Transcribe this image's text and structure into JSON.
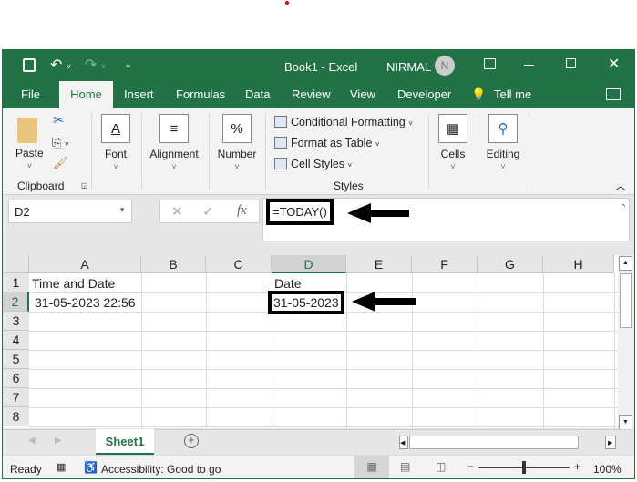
{
  "title": {
    "doc": "Book1",
    "sep": "-",
    "app": "Excel",
    "user": "NIRMAL",
    "avatar": "N"
  },
  "tabs": [
    "File",
    "Home",
    "Insert",
    "Formulas",
    "Data",
    "Review",
    "View",
    "Developer",
    "Tell me"
  ],
  "ribbon": {
    "paste": "Paste",
    "clipboard": "Clipboard",
    "font": "Font",
    "alignment": "Alignment",
    "number": "Number",
    "number_icon": "%",
    "font_icon": "A",
    "cond": "Conditional Formatting",
    "fmt_table": "Format as Table",
    "cell_styles": "Cell Styles",
    "styles": "Styles",
    "cells": "Cells",
    "editing": "Editing"
  },
  "formula": {
    "namebox": "D2",
    "value": "=TODAY()",
    "fx": "fx"
  },
  "columns": [
    "A",
    "B",
    "C",
    "D",
    "E",
    "F",
    "G",
    "H"
  ],
  "rows": [
    "1",
    "2",
    "3",
    "4",
    "5",
    "6",
    "7",
    "8"
  ],
  "cells": {
    "A1": "Time and Date",
    "A2": "31-05-2023 22:56",
    "D1": "Date",
    "D2": "31-05-2023"
  },
  "sheet": {
    "tab": "Sheet1",
    "add": "+"
  },
  "status": {
    "ready": "Ready",
    "accessibility": "Accessibility: Good to go",
    "zoom": "100%"
  },
  "colors": {
    "accent": "#217346"
  }
}
